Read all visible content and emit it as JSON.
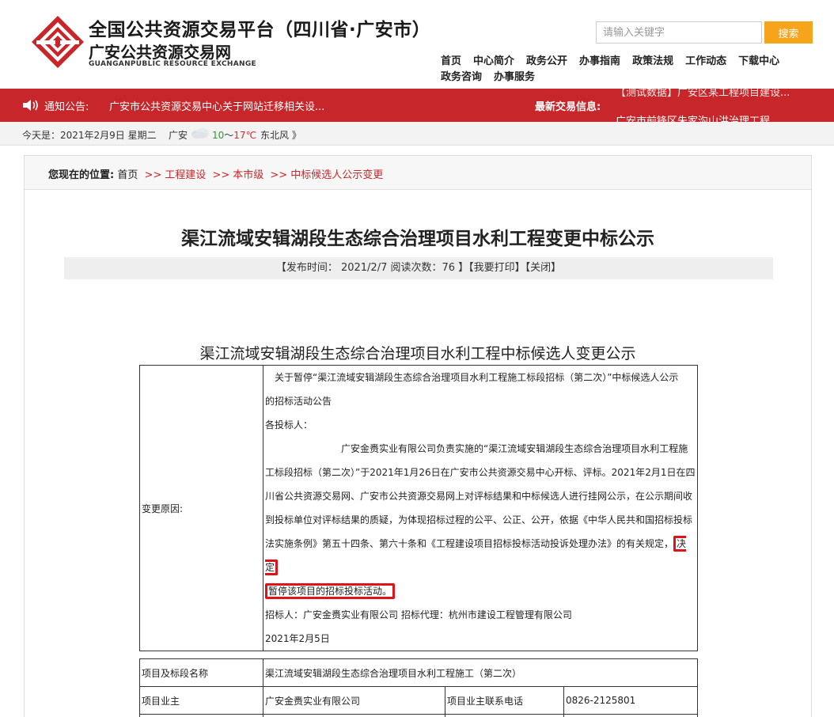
{
  "header": {
    "title_cn": "全国公共资源交易平台（四川省·广安市）",
    "subtitle_cn": "广安公共资源交易网",
    "subtitle_en": "GUANGANPUBLIC RESOURCE EXCHANGE",
    "search": {
      "placeholder": "请输入关键字",
      "button": "搜索"
    },
    "nav": [
      "首页",
      "中心简介",
      "政务公开",
      "办事指南",
      "政策法规",
      "工作动态",
      "下载中心",
      "政务咨询",
      "办事服务"
    ]
  },
  "notice": {
    "label": "通知公告:",
    "text": "广安市公共资源交易中心关于网站迁移相关设...",
    "latest_label": "最新交易信息:",
    "latest_item_1": "【测试数据】广安区某工程项目建设...",
    "latest_item_2": "广安市前锋区朱家沟山洪治理工程..."
  },
  "weather": {
    "date": "今天是：2021年2月9日 星期二",
    "city": "广安",
    "temp_lo": "10",
    "temp_sep": "～",
    "temp_hi": "17℃",
    "wind": "东北风 》"
  },
  "breadcrumb": {
    "you_are_here": "您现在的位置:",
    "home": "首页",
    "sep": ">>",
    "items": [
      "工程建设",
      "本市级",
      "中标候选人公示变更"
    ]
  },
  "article": {
    "title": "渠江流域安辑湖段生态综合治理项目水利工程变更中标公示",
    "meta": "【发布时间：  2021/2/7     阅读次数：76 】【我要打印】【关闭】",
    "sub_title": "渠江流域安辑湖段生态综合治理项目水利工程中标候选人变更公示",
    "change_reason_label": "变更原因:",
    "lines": {
      "l1": "关于暂停“渠江流域安辑湖段生态综合治理项目水利工程施工标段招标（第二次）”中标候选人公示",
      "l2": "的招标活动公告",
      "l3": "各投标人：",
      "l4": "广安金赉实业有限公司负责实施的“渠江流域安辑湖段生态综合治理项目水利工程施",
      "l5": "工标段招标（第二次）”于2021年1月26日在广安市公共资源交易中心开标、评标。2021年2月1日在四",
      "l6": "川省公共资源交易网、广安市公共资源交易网上对评标结果和中标候选人进行挂网公示，在公示期间收",
      "l7": "到投标单位对评标结果的质疑，为体现招标过程的公平、公正、公开，依据《中华人民共和国招标投标",
      "l8a": "法实施条例》第五十四条、第六十条和《工程建设项目招标投标活动投诉处理办法》的有关规定，",
      "l8b": "决定",
      "l9": "暂停该项目的招标投标活动。",
      "l10": "招标人：广安金赉实业有限公司  招标代理：杭州市建设工程管理有限公司",
      "l11": "2021年2月5日"
    },
    "info_table": {
      "r1_label": "项目及标段名称",
      "r1_value": "渠江流域安辑湖段生态综合治理项目水利工程施工（第二次）",
      "r2_label": "项目业主",
      "r2_value": "广安金赉实业有限公司",
      "r2_label2": "项目业主联系电话",
      "r2_value2": "0826-2125801"
    }
  }
}
